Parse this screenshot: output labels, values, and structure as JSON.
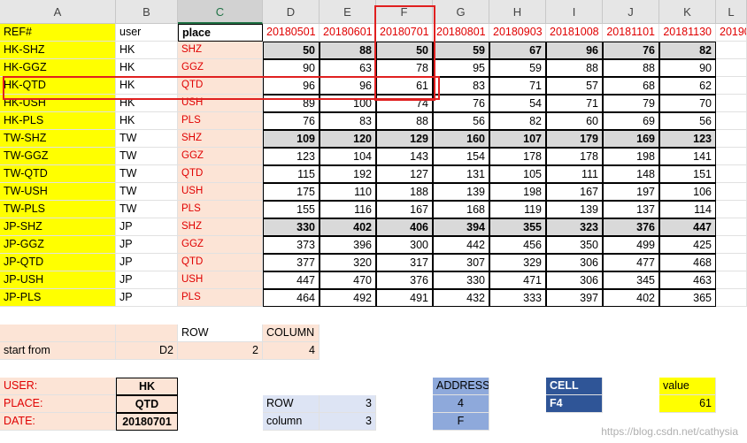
{
  "columns": [
    "A",
    "B",
    "C",
    "D",
    "E",
    "F",
    "G",
    "H",
    "I",
    "J",
    "K",
    "L"
  ],
  "header_row": {
    "ref": "REF#",
    "user": "user",
    "place": "place",
    "dates": [
      "20180501",
      "20180601",
      "20180701",
      "20180801",
      "20180903",
      "20181008",
      "20181101",
      "20181130",
      "20190"
    ]
  },
  "rows": [
    {
      "ref": "HK-SHZ",
      "user": "HK",
      "place": "SHZ",
      "values": [
        50,
        88,
        50,
        59,
        67,
        96,
        76,
        82
      ],
      "subtotal": true
    },
    {
      "ref": "HK-GGZ",
      "user": "HK",
      "place": "GGZ",
      "values": [
        90,
        63,
        78,
        95,
        59,
        88,
        88,
        90
      ]
    },
    {
      "ref": "HK-QTD",
      "user": "HK",
      "place": "QTD",
      "values": [
        96,
        96,
        61,
        83,
        71,
        57,
        68,
        62
      ]
    },
    {
      "ref": "HK-USH",
      "user": "HK",
      "place": "USH",
      "values": [
        89,
        100,
        74,
        76,
        54,
        71,
        79,
        70
      ]
    },
    {
      "ref": "HK-PLS",
      "user": "HK",
      "place": "PLS",
      "values": [
        76,
        83,
        88,
        56,
        82,
        60,
        69,
        56
      ]
    },
    {
      "ref": "TW-SHZ",
      "user": "TW",
      "place": "SHZ",
      "values": [
        109,
        120,
        129,
        160,
        107,
        179,
        169,
        123
      ],
      "subtotal": true
    },
    {
      "ref": "TW-GGZ",
      "user": "TW",
      "place": "GGZ",
      "values": [
        123,
        104,
        143,
        154,
        178,
        178,
        198,
        141
      ]
    },
    {
      "ref": "TW-QTD",
      "user": "TW",
      "place": "QTD",
      "values": [
        115,
        192,
        127,
        131,
        105,
        111,
        148,
        151
      ]
    },
    {
      "ref": "TW-USH",
      "user": "TW",
      "place": "USH",
      "values": [
        175,
        110,
        188,
        139,
        198,
        167,
        197,
        106
      ]
    },
    {
      "ref": "TW-PLS",
      "user": "TW",
      "place": "PLS",
      "values": [
        155,
        116,
        167,
        168,
        119,
        139,
        137,
        114
      ]
    },
    {
      "ref": "JP-SHZ",
      "user": "JP",
      "place": "SHZ",
      "values": [
        330,
        402,
        406,
        394,
        355,
        323,
        376,
        447
      ],
      "subtotal": true
    },
    {
      "ref": "JP-GGZ",
      "user": "JP",
      "place": "GGZ",
      "values": [
        373,
        396,
        300,
        442,
        456,
        350,
        499,
        425
      ]
    },
    {
      "ref": "JP-QTD",
      "user": "JP",
      "place": "QTD",
      "values": [
        377,
        320,
        317,
        307,
        329,
        306,
        477,
        468
      ]
    },
    {
      "ref": "JP-USH",
      "user": "JP",
      "place": "USH",
      "values": [
        447,
        470,
        376,
        330,
        471,
        306,
        345,
        463
      ]
    },
    {
      "ref": "JP-PLS",
      "user": "JP",
      "place": "PLS",
      "values": [
        464,
        492,
        491,
        432,
        333,
        397,
        402,
        365
      ]
    }
  ],
  "lookup": {
    "row_label": "ROW",
    "column_label": "COLUMN",
    "start_label": "start from",
    "start_cell": "D2",
    "row_value": "2",
    "column_value": "4"
  },
  "inputs": {
    "user_label": "USER:",
    "user_value": "HK",
    "place_label": "PLACE:",
    "place_value": "QTD",
    "date_label": "DATE:",
    "date_value": "20180701"
  },
  "calc": {
    "row_label": "ROW",
    "row_value": "3",
    "column_label": "column",
    "column_value": "3",
    "address_label": "ADDRESS",
    "address_row": "4",
    "address_col": "F",
    "cell_label": "CELL",
    "cell_value": "F4",
    "value_label": "value",
    "value": "61"
  },
  "watermark": "https://blog.csdn.net/cathysia",
  "colors": {
    "highlight": "#e02020",
    "yellow": "#ffff00",
    "pink": "#fce4d6",
    "grey": "#d9d9d9"
  }
}
